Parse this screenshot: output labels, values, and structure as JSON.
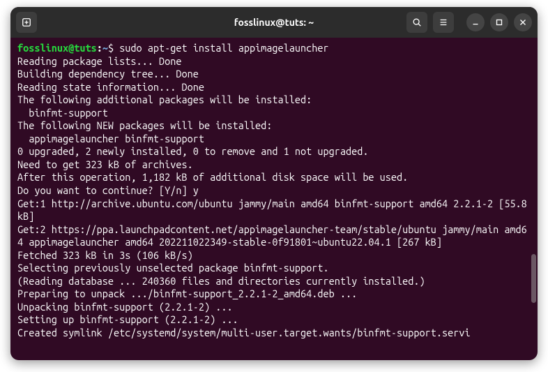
{
  "titlebar": {
    "title": "fosslinux@tuts: ~"
  },
  "prompt": {
    "user_host": "fosslinux@tuts",
    "colon": ":",
    "path": "~",
    "dollar": "$ "
  },
  "command": "sudo apt-get install appimagelauncher",
  "output_lines": [
    "Reading package lists... Done",
    "Building dependency tree... Done",
    "Reading state information... Done",
    "The following additional packages will be installed:",
    "  binfmt-support",
    "The following NEW packages will be installed:",
    "  appimagelauncher binfmt-support",
    "0 upgraded, 2 newly installed, 0 to remove and 1 not upgraded.",
    "Need to get 323 kB of archives.",
    "After this operation, 1,182 kB of additional disk space will be used.",
    "Do you want to continue? [Y/n] y",
    "Get:1 http://archive.ubuntu.com/ubuntu jammy/main amd64 binfmt-support amd64 2.2.1-2 [55.8 kB]",
    "Get:2 https://ppa.launchpadcontent.net/appimagelauncher-team/stable/ubuntu jammy/main amd64 appimagelauncher amd64 202211022349-stable-0f91801~ubuntu22.04.1 [267 kB]",
    "Fetched 323 kB in 3s (106 kB/s)",
    "Selecting previously unselected package binfmt-support.",
    "(Reading database ... 240360 files and directories currently installed.)",
    "Preparing to unpack .../binfmt-support_2.2.1-2_amd64.deb ...",
    "Unpacking binfmt-support (2.2.1-2) ...",
    "Setting up binfmt-support (2.2.1-2) ...",
    "Created symlink /etc/systemd/system/multi-user.target.wants/binfmt-support.servi"
  ]
}
